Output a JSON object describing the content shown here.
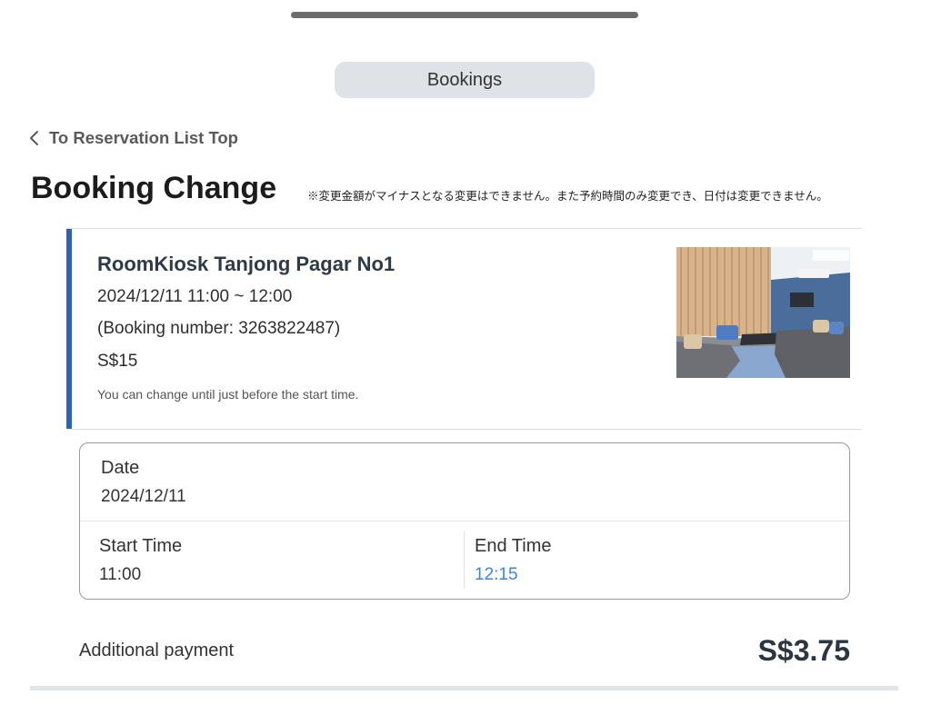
{
  "header": {
    "tab_label": "Bookings"
  },
  "nav": {
    "back_icon": "chevron-left-icon",
    "back_label": "To Reservation List Top"
  },
  "page": {
    "title": "Booking Change",
    "notice": "※変更金額がマイナスとなる変更はできません。また予約時間のみ変更でき、日付は変更できません。"
  },
  "booking": {
    "room_name": "RoomKiosk Tanjong Pagar No1",
    "datetime": "2024/12/11 11:00 ~ 12:00",
    "booking_number": "(Booking number: 3263822487)",
    "price": "S$15",
    "change_note": "You can change until just before the start time."
  },
  "form": {
    "date": {
      "label": "Date",
      "value": "2024/12/11"
    },
    "start_time": {
      "label": "Start Time",
      "value": "11:00"
    },
    "end_time": {
      "label": "End Time",
      "value": "12:15"
    }
  },
  "payment": {
    "label": "Additional payment",
    "amount": "S$3.75"
  },
  "colors": {
    "accent": "#2d62b3",
    "changed_value": "#3b86d9",
    "heading": "#1c1c1c",
    "card_title": "#2e3a46"
  }
}
